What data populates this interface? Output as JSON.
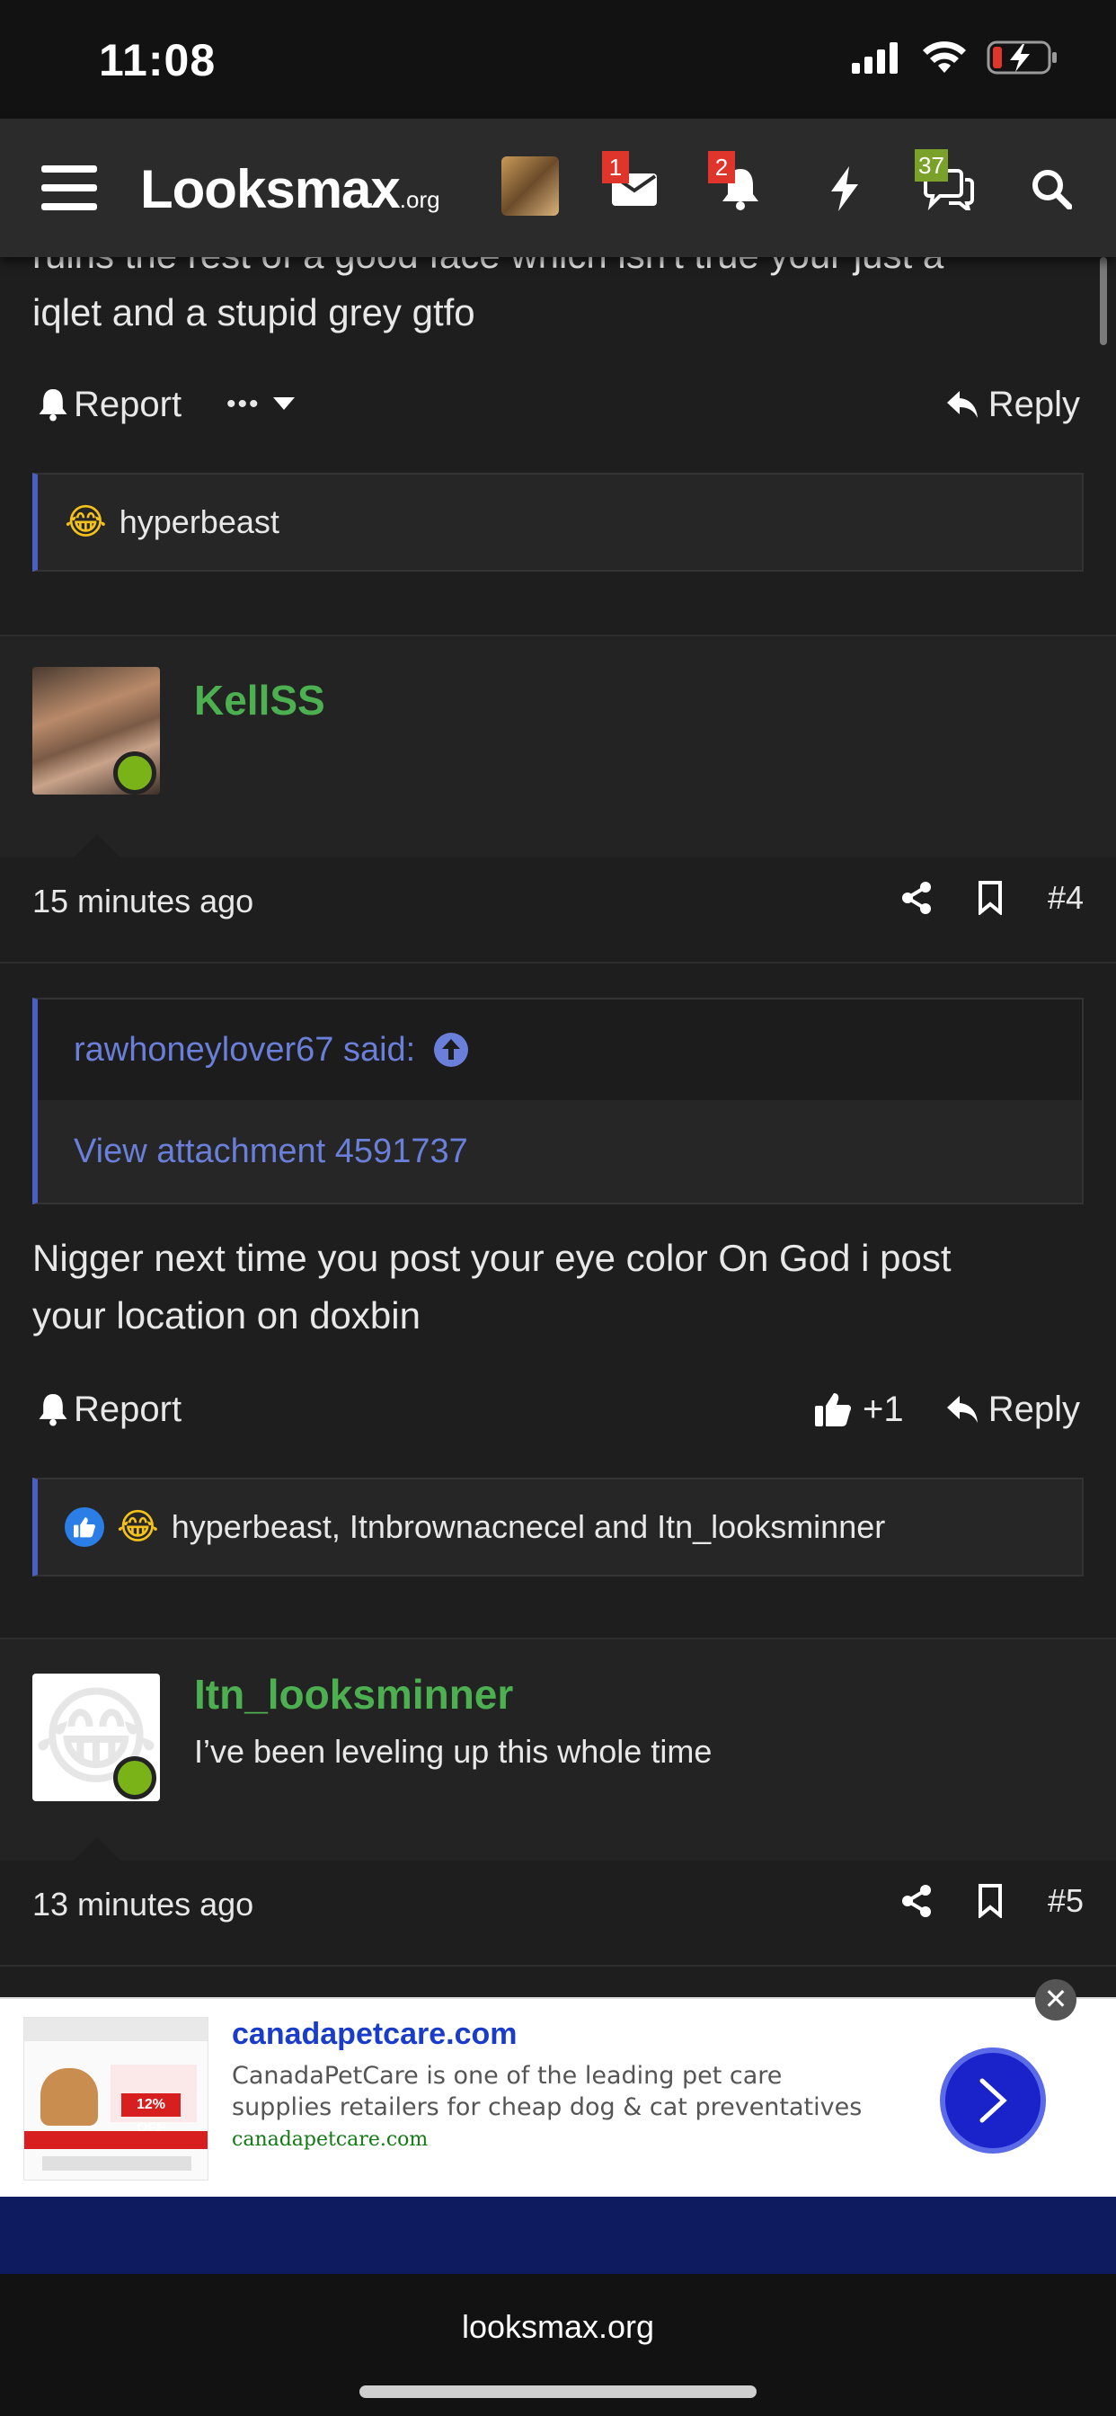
{
  "status_bar": {
    "time": "11:08"
  },
  "nav": {
    "logo": "Looksmax",
    "logo_suffix": ".org",
    "inbox_badge": "1",
    "alerts_badge": "2",
    "chat_badge": "37"
  },
  "thread": {
    "partial_post": {
      "text_line1": "ruins the rest of a good face which isn't true your just a",
      "text_line2": "iqlet and a stupid grey gtfo",
      "report_label": "Report",
      "more_label": "•••",
      "reply_label": "Reply",
      "reactions_text": "hyperbeast"
    },
    "post4": {
      "username": "KellSS",
      "time": "15 minutes ago",
      "post_number": "#4",
      "quote_author": "rawhoneylover67 said:",
      "quote_body": "View attachment 4591737",
      "text_line1": "Nigger next time you post your eye color On God i post",
      "text_line2": "your location on doxbin",
      "report_label": "Report",
      "like_count": "+1",
      "reply_label": "Reply",
      "reactions_text": "hyperbeast, Itnbrownacnecel and Itn_looksminner"
    },
    "post5": {
      "username": "Itn_looksminner",
      "user_title": "I’ve been leveling up this whole time",
      "time": "13 minutes ago",
      "post_number": "#5"
    }
  },
  "ad": {
    "title": "canadapetcare.com",
    "description": "CanadaPetCare is one of the leading pet care supplies retailers for cheap dog & cat preventatives",
    "url": "canadapetcare.com",
    "thumb_badge": "12% OFF"
  },
  "browser": {
    "url": "looksmax.org"
  },
  "colors": {
    "accent_green": "#4caf50",
    "quote_blue": "#6a7fd9",
    "badge_red": "#e0352b"
  }
}
